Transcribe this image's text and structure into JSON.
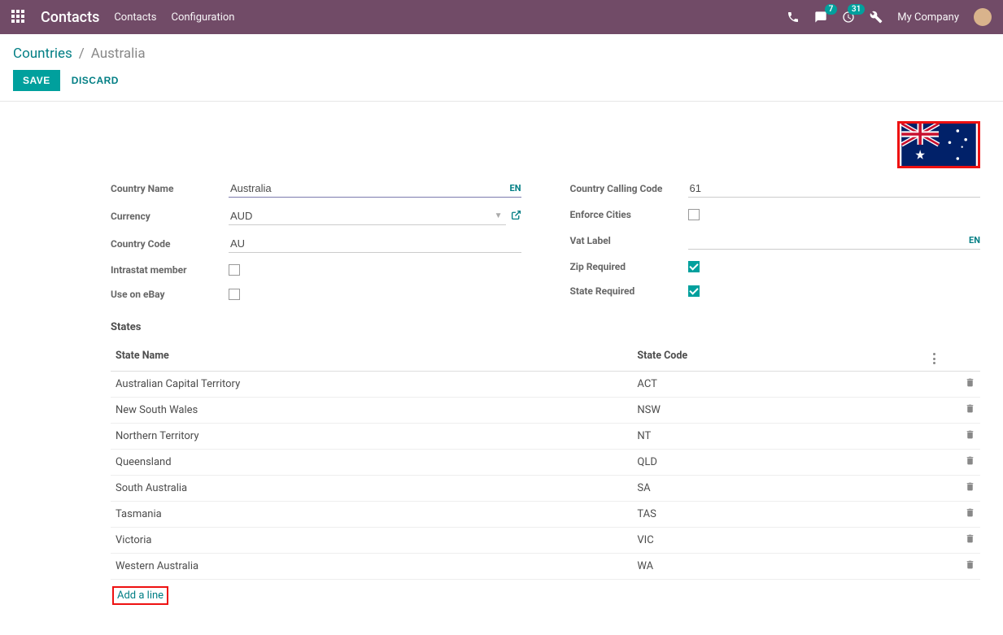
{
  "topbar": {
    "app": "Contacts",
    "nav": {
      "contacts": "Contacts",
      "configuration": "Configuration"
    },
    "msg_count": "7",
    "activity_count": "31",
    "company": "My Company"
  },
  "breadcrumbs": {
    "root": "Countries",
    "leaf": "Australia"
  },
  "buttons": {
    "save": "SAVE",
    "discard": "DISCARD"
  },
  "labels": {
    "country_name": "Country Name",
    "currency": "Currency",
    "country_code": "Country Code",
    "intrastat": "Intrastat member",
    "ebay": "Use on eBay",
    "calling": "Country Calling Code",
    "enforce": "Enforce Cities",
    "vat": "Vat Label",
    "zip": "Zip Required",
    "state_req": "State Required",
    "states": "States"
  },
  "fields": {
    "country_name": "Australia",
    "currency": "AUD",
    "country_code": "AU",
    "calling": "61",
    "vat": "",
    "intrastat": false,
    "ebay": false,
    "enforce": false,
    "zip": true,
    "state_req": true
  },
  "lang_badge": "EN",
  "states_header": {
    "name": "State Name",
    "code": "State Code"
  },
  "states": [
    {
      "name": "Australian Capital Territory",
      "code": "ACT"
    },
    {
      "name": "New South Wales",
      "code": "NSW"
    },
    {
      "name": "Northern Territory",
      "code": "NT"
    },
    {
      "name": "Queensland",
      "code": "QLD"
    },
    {
      "name": "South Australia",
      "code": "SA"
    },
    {
      "name": "Tasmania",
      "code": "TAS"
    },
    {
      "name": "Victoria",
      "code": "VIC"
    },
    {
      "name": "Western Australia",
      "code": "WA"
    }
  ],
  "add_line": "Add a line"
}
